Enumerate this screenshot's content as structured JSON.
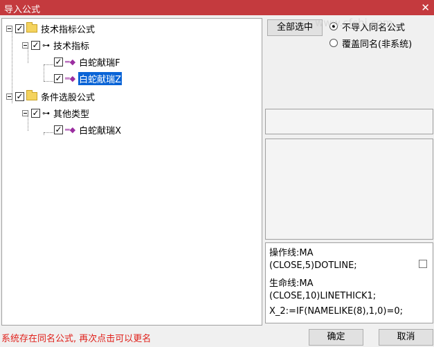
{
  "window": {
    "title": "导入公式"
  },
  "tree": {
    "nodes": [
      {
        "label": "技术指标公式"
      },
      {
        "label": "技术指标"
      },
      {
        "label": "白蛇献瑞F"
      },
      {
        "label": "白蛇献瑞Z"
      },
      {
        "label": "条件选股公式"
      },
      {
        "label": "其他类型"
      },
      {
        "label": "白蛇献瑞X"
      }
    ]
  },
  "options": {
    "select_all_label": "全部选中",
    "radio_skip_label": "不导入同名公式",
    "radio_overwrite_label": "覆盖同名(非系统)"
  },
  "code_preview": {
    "lines": [
      "操作线:MA",
      "(CLOSE,5)DOTLINE;",
      "生命线:MA",
      "(CLOSE,10)LINETHICK1;",
      "X_2:=IF(NAMELIKE(8),1,0)=0;"
    ]
  },
  "status": {
    "message": "系统存在同名公式, 再次点击可以更名"
  },
  "buttons": {
    "ok_label": "确定",
    "cancel_label": "取消"
  },
  "watermark": {
    "text": "www.cfchi.com"
  },
  "colors": {
    "titlebar": "#c43a3e",
    "selection": "#0a64d6",
    "status_text": "#e0201a",
    "formula_icon": "#9b2ea0"
  }
}
